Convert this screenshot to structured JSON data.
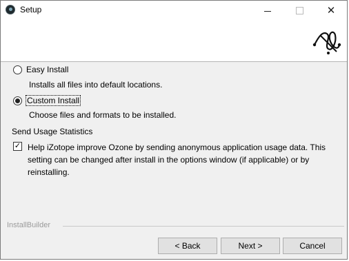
{
  "window": {
    "title": "Setup"
  },
  "options": [
    {
      "label": "Easy Install",
      "description": "Installs all files into default locations.",
      "selected": false
    },
    {
      "label": "Custom Install",
      "description": "Choose files and formats to be installed.",
      "selected": true
    }
  ],
  "usage": {
    "section_label": "Send Usage Statistics",
    "checkbox_text": "Help iZotope improve Ozone by sending anonymous application usage data. This setting can be changed after install in the options window (if applicable) or by reinstalling.",
    "checked": true
  },
  "footer": {
    "brand": "InstallBuilder",
    "back_label": "< Back",
    "next_label": "Next >",
    "cancel_label": "Cancel"
  },
  "icons": {
    "app": "ozone-app-icon",
    "logo": "izotope-logo-icon",
    "check": "checkmark-icon"
  }
}
